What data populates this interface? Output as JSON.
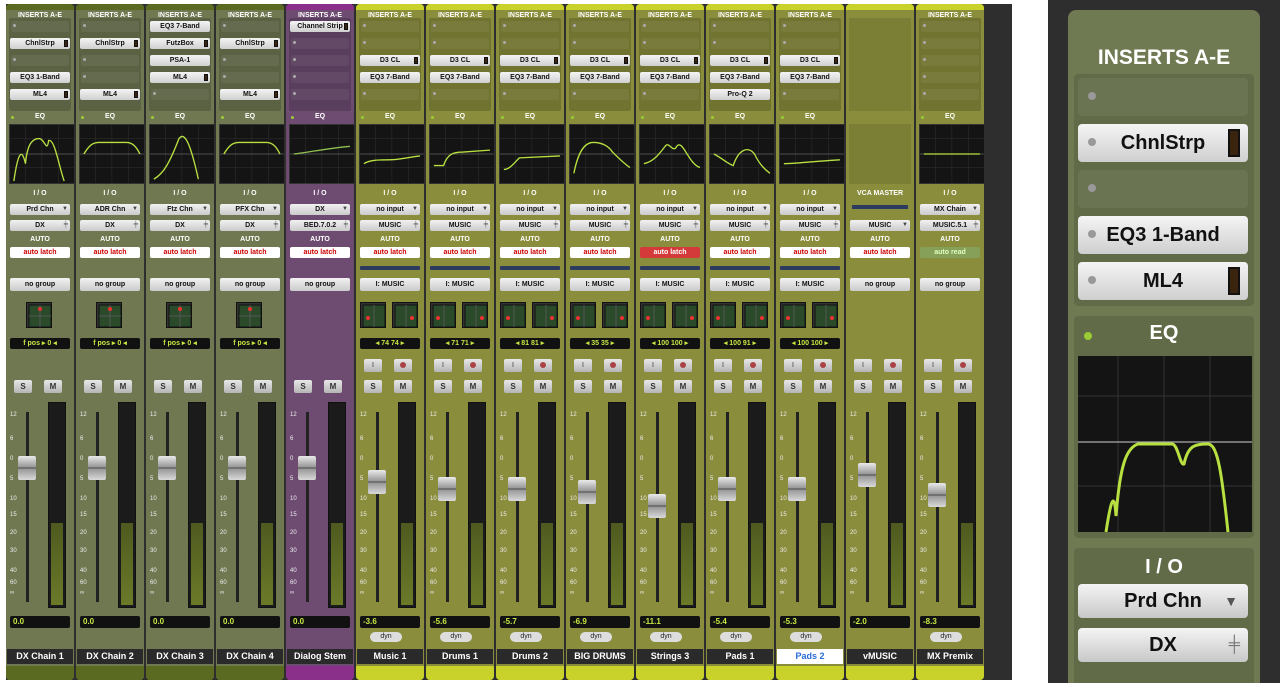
{
  "section_labels": {
    "inserts": "INSERTS A-E",
    "eq": "EQ",
    "io": "I / O",
    "auto": "AUTO",
    "vca_master": "VCA MASTER"
  },
  "colors": {
    "green_strip": "#707852",
    "purple_strip": "#6e4c72",
    "yellow_strip": "#8a8d3c",
    "meter_level": "#c6e843",
    "auto_latch_text": "#cc0000",
    "auto_latch_active": "#d53a3a"
  },
  "strips": [
    {
      "name": "DX Chain 1",
      "color": "green",
      "inserts": [
        "",
        "ChnlStrp",
        "",
        "EQ3 1-Band",
        "ML4"
      ],
      "io_in": "Prd Chn",
      "io_out": "DX",
      "auto": "auto latch",
      "group": "no group",
      "pan": "f pos  ▸  0  ◂",
      "volume": "0.0",
      "fader_level": 0.26
    },
    {
      "name": "DX Chain 2",
      "color": "green",
      "inserts": [
        "",
        "ChnlStrp",
        "",
        "",
        "ML4"
      ],
      "io_in": "ADR Chn",
      "io_out": "DX",
      "auto": "auto latch",
      "group": "no group",
      "pan": "f pos  ▸  0  ◂",
      "volume": "0.0",
      "fader_level": 0.26
    },
    {
      "name": "DX Chain 3",
      "color": "green",
      "inserts": [
        "EQ3 7-Band",
        "FutzBox",
        "PSA-1",
        "ML4",
        ""
      ],
      "io_in": "Ftz Chn",
      "io_out": "DX",
      "auto": "auto latch",
      "group": "no group",
      "pan": "f pos  ▸  0  ◂",
      "volume": "0.0",
      "fader_level": 0.26
    },
    {
      "name": "DX Chain 4",
      "color": "green",
      "inserts": [
        "",
        "ChnlStrp",
        "",
        "",
        "ML4"
      ],
      "io_in": "PFX Chn",
      "io_out": "DX",
      "auto": "auto latch",
      "group": "no group",
      "pan": "f pos  ▸  0  ◂",
      "volume": "0.0",
      "fader_level": 0.26
    },
    {
      "name": "Dialog Stem",
      "color": "purple",
      "inserts": [
        "Channel Strip",
        "",
        "",
        "",
        ""
      ],
      "io_in": "DX",
      "io_out": "BED.7.0.2",
      "auto": "auto latch",
      "group": "no group",
      "pan": "",
      "volume": "0.0",
      "fader_level": 0.26
    },
    {
      "name": "Music 1",
      "color": "yellow",
      "inserts": [
        "",
        "",
        "D3 CL",
        "EQ3 7-Band",
        ""
      ],
      "io_in": "no input",
      "io_out": "MUSIC",
      "auto": "auto latch",
      "group": "I: MUSIC",
      "pan": "◂ 74    74 ▸",
      "volume": "-3.6",
      "fader_level": 0.34
    },
    {
      "name": "Drums 1",
      "color": "yellow",
      "inserts": [
        "",
        "",
        "D3 CL",
        "EQ3 7-Band",
        ""
      ],
      "io_in": "no input",
      "io_out": "MUSIC",
      "auto": "auto latch",
      "group": "I: MUSIC",
      "pan": "◂ 71    71 ▸",
      "volume": "-5.6",
      "fader_level": 0.38
    },
    {
      "name": "Drums 2",
      "color": "yellow",
      "inserts": [
        "",
        "",
        "D3 CL",
        "EQ3 7-Band",
        ""
      ],
      "io_in": "no input",
      "io_out": "MUSIC",
      "auto": "auto latch",
      "group": "I: MUSIC",
      "pan": "◂ 81    81 ▸",
      "volume": "-5.7",
      "fader_level": 0.38
    },
    {
      "name": "BIG DRUMS",
      "color": "yellow",
      "inserts": [
        "",
        "",
        "D3 CL",
        "EQ3 7-Band",
        ""
      ],
      "io_in": "no input",
      "io_out": "MUSIC",
      "auto": "auto latch",
      "group": "I: MUSIC",
      "pan": "◂ 35    35 ▸",
      "volume": "-6.9",
      "fader_level": 0.4
    },
    {
      "name": "Strings 3",
      "color": "yellow",
      "inserts": [
        "",
        "",
        "D3 CL",
        "EQ3 7-Band",
        ""
      ],
      "io_in": "no input",
      "io_out": "MUSIC",
      "auto": "auto latch",
      "group": "I: MUSIC",
      "pan": "◂ 100  100 ▸",
      "volume": "-11.1",
      "fader_level": 0.48
    },
    {
      "name": "Pads 1",
      "color": "yellow",
      "inserts": [
        "",
        "",
        "D3 CL",
        "EQ3 7-Band",
        "Pro-Q 2"
      ],
      "io_in": "no input",
      "io_out": "MUSIC",
      "auto": "auto latch",
      "group": "I: MUSIC",
      "pan": "◂ 100    91 ▸",
      "volume": "-5.4",
      "fader_level": 0.38
    },
    {
      "name": "Pads 2",
      "color": "yellow",
      "inserts": [
        "",
        "",
        "D3 CL",
        "EQ3 7-Band",
        ""
      ],
      "io_in": "no input",
      "io_out": "MUSIC",
      "auto": "auto latch",
      "group": "I: MUSIC",
      "pan": "◂ 100  100 ▸",
      "volume": "-5.3",
      "fader_level": 0.38
    },
    {
      "name": "vMUSIC",
      "color": "yellow",
      "inserts": [],
      "io_in": "",
      "io_out": "MUSIC",
      "auto": "auto latch",
      "group": "no group",
      "pan": "",
      "volume": "-2.0",
      "fader_level": 0.3
    },
    {
      "name": "MX Premix",
      "color": "yellow",
      "inserts": [
        "",
        "",
        "",
        "",
        ""
      ],
      "io_in": "MX Chain",
      "io_out": "MUSIC.5.1",
      "auto": "auto read",
      "group": "no group",
      "pan": "",
      "volume": "-8.3",
      "fader_level": 0.42
    }
  ],
  "buttons": {
    "solo": "S",
    "mute": "M",
    "input": "I",
    "dyn": "dyn"
  },
  "fader_scale": [
    "12",
    "6",
    "0",
    "5",
    "10",
    "15",
    "20",
    "30",
    "40",
    "60",
    "∞"
  ],
  "zoom": {
    "inserts_label": "INSERTS A-E",
    "insert_1": "ChnlStrp",
    "insert_2": "EQ3 1-Band",
    "insert_3": "ML4",
    "eq_label": "EQ",
    "io_label": "I / O",
    "io_in": "Prd Chn",
    "io_out": "DX"
  }
}
